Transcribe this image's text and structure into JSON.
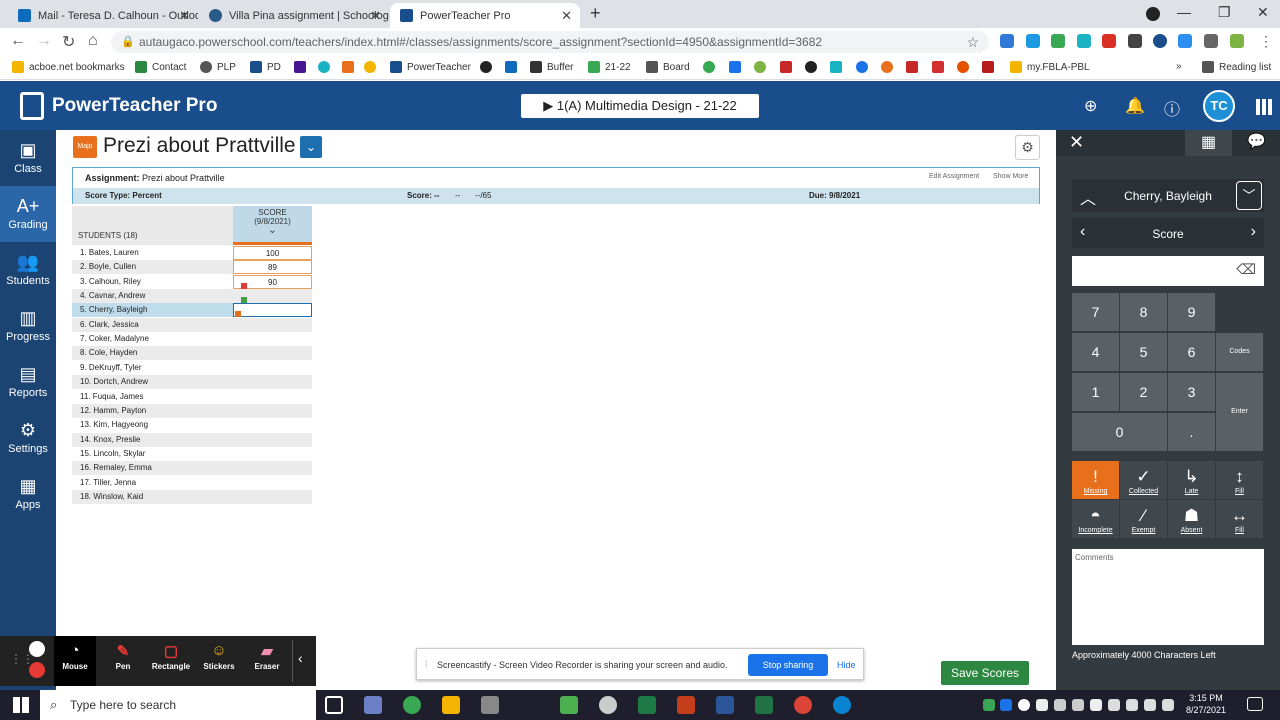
{
  "browser": {
    "tabs": [
      {
        "label": "Mail - Teresa D. Calhoun - Outloo",
        "color": "#0f6cbd"
      },
      {
        "label": "Villa Pina assignment | Schoolog",
        "color": "#2a5a8a"
      },
      {
        "label": "PowerTeacher Pro",
        "color": "#1a4d8c"
      }
    ],
    "new_tab": "+",
    "url": "autaugaco.powerschool.com/teachers/index.html#/classes/assignments/score_assignment?sectionId=4950&assignmentId=3682",
    "bookmarks": [
      "acboe.net bookmarks",
      "Contact",
      "PLP",
      "PD",
      "",
      "",
      "",
      "",
      "PowerTeacher",
      "",
      "",
      "Buffer",
      "21-22",
      "Board",
      "my.FBLA-PBL"
    ],
    "reading_list": "Reading list"
  },
  "app": {
    "title": "PowerTeacher Pro",
    "class_selector": "▶  1(A) Multimedia Design - 21-22",
    "avatar": "TC"
  },
  "sidebar": [
    {
      "label": "Class",
      "icon": "class-icon"
    },
    {
      "label": "Grading",
      "icon": "grading-icon"
    },
    {
      "label": "Students",
      "icon": "students-icon"
    },
    {
      "label": "Progress",
      "icon": "progress-icon"
    },
    {
      "label": "Reports",
      "icon": "reports-icon"
    },
    {
      "label": "Settings",
      "icon": "settings-icon"
    },
    {
      "label": "Apps",
      "icon": "apps-icon"
    }
  ],
  "assignment": {
    "category": "Majo",
    "title": "Prezi about Prattville",
    "assignment_label": "Assignment:",
    "assignment_name": "Prezi about Prattville",
    "edit_link": "Edit Assignment",
    "show_more": "Show More",
    "score_type": "Score Type: Percent",
    "score_label": "Score: --",
    "score_dash": "--",
    "score_total": "--/65",
    "due": "Due: 9/8/2021"
  },
  "grid": {
    "students_header": "STUDENTS (18)",
    "score_header": "SCORE",
    "score_date": "(9/8/2021)",
    "students": [
      {
        "name": "1.  Bates, Lauren",
        "score": "100"
      },
      {
        "name": "2.  Boyle, Cullen",
        "score": "89"
      },
      {
        "name": "3.  Calhoun, Riley",
        "score": "90"
      },
      {
        "name": "4.  Cavnar, Andrew",
        "score": ""
      },
      {
        "name": "5.  Cherry, Bayleigh",
        "score": ""
      },
      {
        "name": "6.  Clark, Jessica",
        "score": ""
      },
      {
        "name": "7.  Coker, Madalyne",
        "score": ""
      },
      {
        "name": "8.  Cole, Hayden",
        "score": ""
      },
      {
        "name": "9.  DeKruyff, Tyler",
        "score": ""
      },
      {
        "name": "10.  Dortch, Andrew",
        "score": ""
      },
      {
        "name": "11.  Fuqua, James",
        "score": ""
      },
      {
        "name": "12.  Hamm, Payton",
        "score": ""
      },
      {
        "name": "13.  Kim, Hagyeong",
        "score": ""
      },
      {
        "name": "14.  Knox, Preslie",
        "score": ""
      },
      {
        "name": "15.  Lincoln, Skylar",
        "score": ""
      },
      {
        "name": "16.  Remaley, Emma",
        "score": ""
      },
      {
        "name": "17.  Tiller, Jenna",
        "score": ""
      },
      {
        "name": "18.  Winslow, Kaid",
        "score": ""
      }
    ]
  },
  "panel": {
    "student": "Cherry, Bayleigh",
    "field": "Score",
    "keys": [
      "7",
      "8",
      "9",
      "4",
      "5",
      "6",
      "1",
      "2",
      "3",
      "0",
      "."
    ],
    "codes_label": "Codes",
    "enter_label": "Enter",
    "code_buttons": [
      {
        "label": "Missing",
        "icon": "missing-icon",
        "active": true
      },
      {
        "label": "Collected",
        "icon": "check-icon",
        "active": false
      },
      {
        "label": "Late",
        "icon": "late-icon",
        "active": false
      },
      {
        "label": "Fill",
        "icon": "fill-vertical-icon",
        "active": false
      },
      {
        "label": "Incomplete",
        "icon": "incomplete-icon",
        "active": false
      },
      {
        "label": "Exempt",
        "icon": "exempt-icon",
        "active": false
      },
      {
        "label": "Absent",
        "icon": "absent-icon",
        "active": false
      },
      {
        "label": "Fill",
        "icon": "fill-horizontal-icon",
        "active": false
      }
    ],
    "comments_placeholder": "Comments",
    "chars_left": "Approximately 4000 Characters Left",
    "save": "Save Scores"
  },
  "recorder": {
    "tools": [
      "Mouse",
      "Pen",
      "Rectangle",
      "Stickers",
      "Eraser"
    ]
  },
  "share_bar": {
    "message": "Screencastify - Screen Video Recorder is sharing your screen and audio.",
    "stop": "Stop sharing",
    "hide": "Hide"
  },
  "taskbar": {
    "search": "Type here to search",
    "time": "3:15 PM",
    "date": "8/27/2021"
  },
  "colors": {
    "header": "#1a4d8c",
    "sidebar": "#1c4473",
    "accent_orange": "#e8701c",
    "save_green": "#2c8740"
  }
}
